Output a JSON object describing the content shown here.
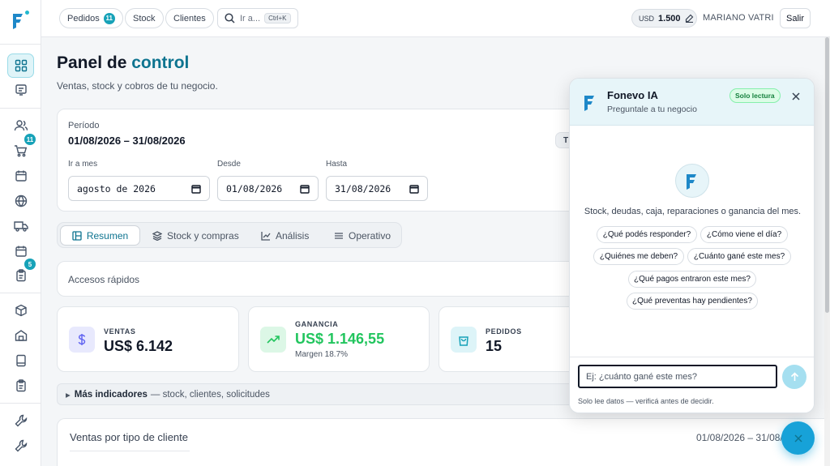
{
  "topbar": {
    "orders_label": "Pedidos",
    "orders_count": "11",
    "stock_label": "Stock",
    "clients_label": "Clientes",
    "search_placeholder": "Ir a...",
    "search_shortcut": "Ctrl+K",
    "currency": "USD",
    "rate": "1.500",
    "user_name": "MARIANO VATRI",
    "logout_label": "Salir"
  },
  "sidebar": {
    "badges": {
      "cart": "11",
      "tasks": "5"
    },
    "items": [
      "dashboard-icon",
      "receipt-icon",
      "users-icon",
      "cart-icon",
      "calendar-icon",
      "globe-icon",
      "truck-icon",
      "calendar-icon",
      "clipboard-icon",
      "box-icon",
      "warehouse-icon",
      "tablet-icon",
      "clipboard-icon",
      "wrench-icon",
      "wrench-icon"
    ]
  },
  "page": {
    "title_part1": "Panel de",
    "title_part2": "control",
    "subtitle": "Ventas, stock y cobros de tu negocio."
  },
  "period": {
    "label": "Período",
    "value": "01/08/2026 – 31/08/2026",
    "go_month_label": "Ir a mes",
    "month_value": "agosto de 2026",
    "from_label": "Desde",
    "from_value": "01/08/2026",
    "to_label": "Hasta",
    "to_value": "31/08/2026",
    "partial_button": "T"
  },
  "tabs": [
    "Resumen",
    "Stock y compras",
    "Análisis",
    "Operativo"
  ],
  "quick_access": "Accesos rápidos",
  "kpis": {
    "sales": {
      "label": "VENTAS",
      "value": "US$ 6.142"
    },
    "profit": {
      "label": "GANANCIA",
      "value": "US$ 1.146,55",
      "margin": "Margen 18.7%"
    },
    "orders": {
      "label": "PEDIDOS",
      "value": "15"
    }
  },
  "more_indicators": {
    "arrow": "▸",
    "title": "Más indicadores",
    "rest": "— stock, clientes, solicitudes"
  },
  "sales_by_type": {
    "title": "Ventas por tipo de cliente",
    "period": "01/08/2026 – 31/08/2026"
  },
  "assistant": {
    "name": "Fonevo IA",
    "tagline": "Preguntale a tu negocio",
    "readonly_badge": "Solo lectura",
    "intro": "Stock, deudas, caja, reparaciones o ganancia del mes.",
    "suggestions": [
      "¿Qué podés responder?",
      "¿Cómo viene el día?",
      "¿Quiénes me deben?",
      "¿Cuánto gané este mes?",
      "¿Qué pagos entraron este mes?",
      "¿Qué preventas hay pendientes?"
    ],
    "input_placeholder": "Ej: ¿cuánto gané este mes?",
    "disclaimer": "Solo lee datos — verificá antes de decidir."
  },
  "colors": {
    "accent": "#17a2b8",
    "brand_dark": "#0e7490",
    "profit_green": "#22c55e",
    "sales_purple": "#6366f1"
  }
}
